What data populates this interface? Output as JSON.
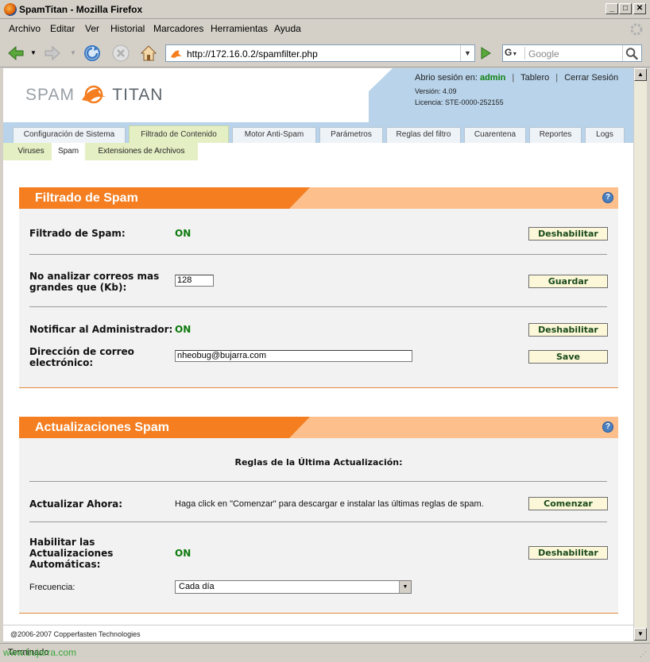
{
  "window": {
    "title": "SpamTitan - Mozilla Firefox"
  },
  "menu": [
    "Archivo",
    "Editar",
    "Ver",
    "Historial",
    "Marcadores",
    "Herramientas",
    "Ayuda"
  ],
  "nav": {
    "url": "http://172.16.0.2/spamfilter.php",
    "search_engine": "G",
    "search_placeholder": "Google"
  },
  "header": {
    "logo_left": "SPAM",
    "logo_right": "TITAN",
    "session_label": "Abrio sesión en:",
    "user": "admin",
    "link_dashboard": "Tablero",
    "link_logout": "Cerrar Sesión",
    "version": "Versión: 4.09",
    "license": "Licencia: STE-0000-252155"
  },
  "tabs": [
    {
      "label": "Configuración de Sistema"
    },
    {
      "label": "Filtrado de Contenido"
    },
    {
      "label": "Motor Anti-Spam"
    },
    {
      "label": "Parámetros"
    },
    {
      "label": "Reglas del filtro"
    },
    {
      "label": "Cuarentena"
    },
    {
      "label": "Reportes"
    },
    {
      "label": "Logs"
    }
  ],
  "subtabs": [
    {
      "label": "Viruses"
    },
    {
      "label": "Spam"
    },
    {
      "label": "Extensiones de Archivos"
    }
  ],
  "spam_panel": {
    "title": "Filtrado de Spam",
    "filter_label": "Filtrado de Spam:",
    "filter_status": "ON",
    "filter_button": "Deshabilitar",
    "size_label_1": "No analizar correos mas",
    "size_label_2": "grandes que (Kb):",
    "size_value": "128",
    "size_button": "Guardar",
    "notify_label": "Notificar al Administrador:",
    "notify_status": "ON",
    "notify_button": "Deshabilitar",
    "email_label_1": "Dirección de correo",
    "email_label_2": "electrónico:",
    "email_value": "nheobug@bujarra.com",
    "email_button": "Save"
  },
  "update_panel": {
    "title": "Actualizaciones Spam",
    "last_rules_heading": "Reglas de la Última Actualización:",
    "update_label": "Actualizar Ahora:",
    "update_text": "Haga click en \"Comenzar\" para descargar e instalar las últimas reglas de spam.",
    "update_button": "Comenzar",
    "auto_label_1": "Habilitar las",
    "auto_label_2": "Actualizaciones",
    "auto_label_3": "Automáticas:",
    "auto_status": "ON",
    "auto_button": "Deshabilitar",
    "freq_label": "Frecuencia:",
    "freq_value": "Cada día"
  },
  "footer": "@2006-2007 Copperfasten Technologies",
  "status": "Terminado",
  "watermark": "www.bujarra.com"
}
